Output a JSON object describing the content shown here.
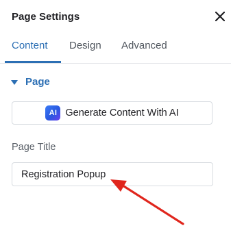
{
  "panel": {
    "title": "Page Settings",
    "close_icon": "close-icon"
  },
  "tabs": [
    {
      "label": "Content",
      "active": true
    },
    {
      "label": "Design",
      "active": false
    },
    {
      "label": "Advanced",
      "active": false
    }
  ],
  "section": {
    "label": "Page",
    "expanded": true
  },
  "ai_button": {
    "badge": "AI",
    "label": "Generate Content With AI"
  },
  "page_title": {
    "label": "Page Title",
    "value": "Registration Popup"
  },
  "colors": {
    "accent": "#2c6fb4",
    "annotation_arrow": "#e0261d"
  }
}
